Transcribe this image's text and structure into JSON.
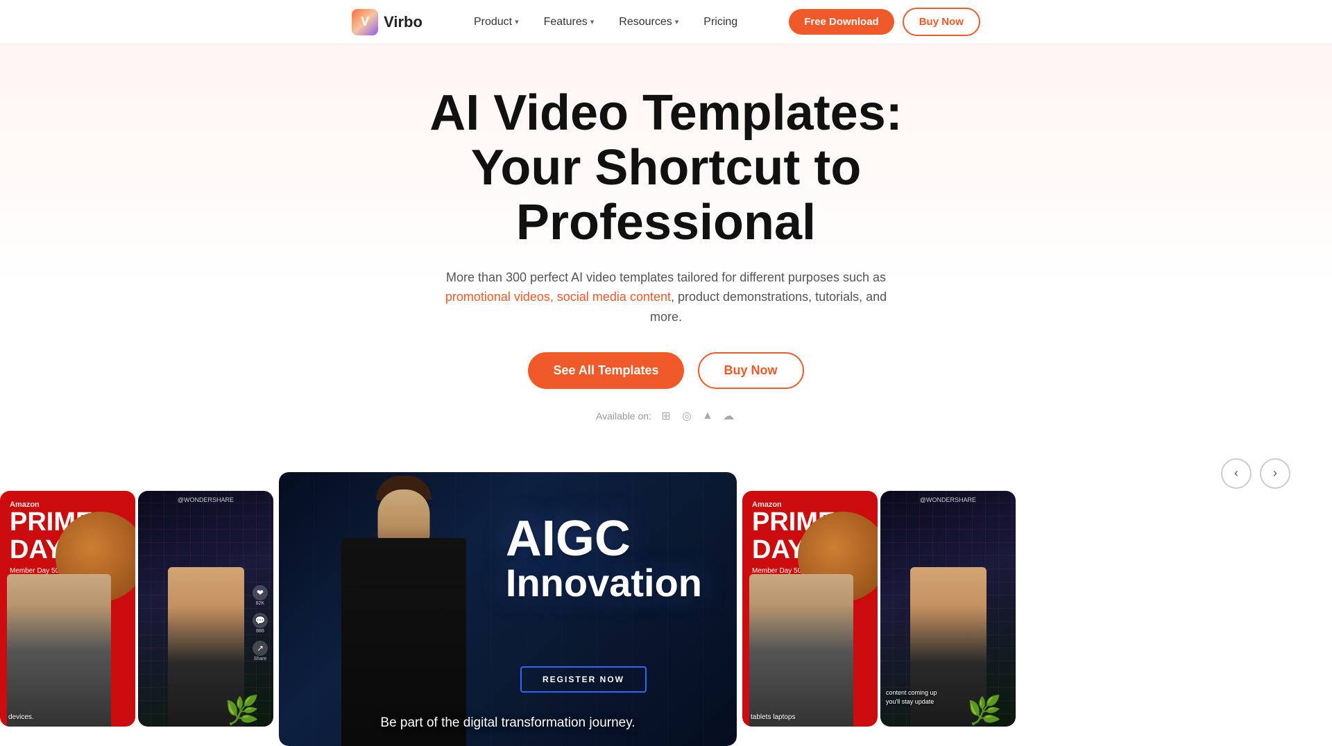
{
  "nav": {
    "logo_text": "Virbo",
    "items": [
      {
        "label": "Product",
        "has_dropdown": true
      },
      {
        "label": "Features",
        "has_dropdown": true
      },
      {
        "label": "Resources",
        "has_dropdown": true
      },
      {
        "label": "Pricing",
        "has_dropdown": false
      }
    ],
    "btn_free_download": "Free Download",
    "btn_buy_now": "Buy Now"
  },
  "hero": {
    "title_line1": "AI Video Templates:",
    "title_line2": "Your Shortcut to Professional",
    "description": "More than 300 perfect AI video templates tailored for different purposes such as promotional videos, social media content, product demonstrations, tutorials, and more.",
    "btn_see_templates": "See All Templates",
    "btn_buy_now": "Buy Now",
    "available_label": "Available on:"
  },
  "carousel": {
    "prev_label": "‹",
    "next_label": "›",
    "cards": [
      {
        "type": "amazon",
        "brand": "Amazon",
        "title": "PRIME DAY",
        "subtitle": "Member Day 50% off",
        "bottom_text": "devices."
      },
      {
        "type": "tiktok",
        "handle": "@WONDERSHARE",
        "actions": [
          "❤",
          "💬",
          "↗"
        ]
      },
      {
        "type": "center",
        "title": "AIGC",
        "subtitle": "Innovation",
        "cta": "REGISTER NOW",
        "bottom_text": "Be part of the digital transformation journey."
      },
      {
        "type": "amazon2",
        "brand": "Amazon",
        "title": "PRIME DAY",
        "subtitle": "Member Day 50% off",
        "bottom_text": "tablets laptops"
      },
      {
        "type": "tiktok2",
        "handle": "@WONDERSHARE",
        "bottom_text": "content coming up\nyou'll stay update"
      }
    ]
  }
}
